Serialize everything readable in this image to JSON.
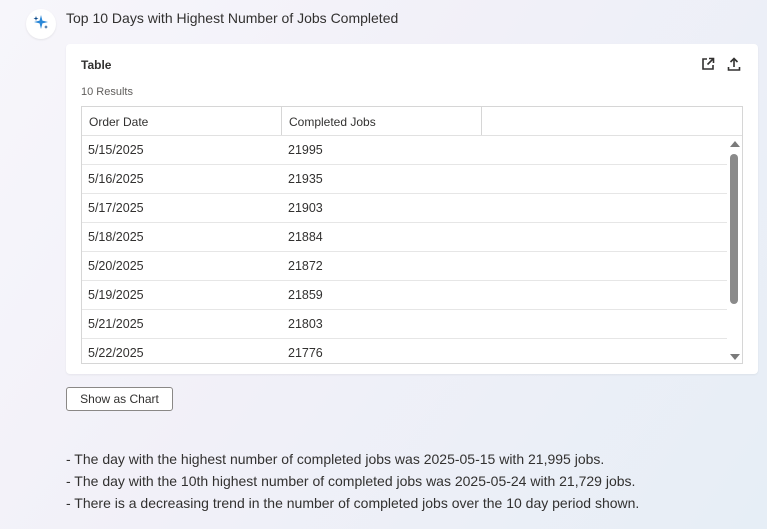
{
  "message": {
    "title": "Top 10 Days with Highest Number of Jobs Completed",
    "avatar_icon": "sparkle-icon",
    "accent": "#2b88d8"
  },
  "card": {
    "title": "Table",
    "result_count": "10 Results",
    "actions": [
      {
        "icon": "open-external-icon"
      },
      {
        "icon": "export-icon"
      }
    ]
  },
  "table": {
    "columns": [
      "Order Date",
      "Completed Jobs",
      ""
    ],
    "rows": [
      {
        "date": "5/15/2025",
        "jobs": "21995"
      },
      {
        "date": "5/16/2025",
        "jobs": "21935"
      },
      {
        "date": "5/17/2025",
        "jobs": "21903"
      },
      {
        "date": "5/18/2025",
        "jobs": "21884"
      },
      {
        "date": "5/20/2025",
        "jobs": "21872"
      },
      {
        "date": "5/19/2025",
        "jobs": "21859"
      },
      {
        "date": "5/21/2025",
        "jobs": "21803"
      },
      {
        "date": "5/22/2025",
        "jobs": "21776"
      }
    ]
  },
  "show_chart_label": "Show as Chart",
  "summary": [
    "- The day with the highest number of completed jobs was 2025-05-15 with 21,995 jobs.",
    "- The day with the 10th highest number of completed jobs was 2025-05-24 with 21,729 jobs.",
    "- There is a decreasing trend in the number of completed jobs over the 10 day period shown."
  ]
}
